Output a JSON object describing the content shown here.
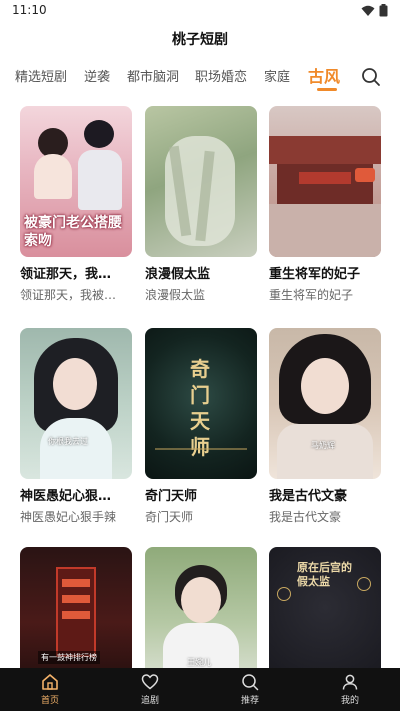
{
  "status": {
    "time": "11:10"
  },
  "app": {
    "title": "桃子短剧"
  },
  "tabs": [
    {
      "label": "精选短剧"
    },
    {
      "label": "逆袭"
    },
    {
      "label": "都市脑洞"
    },
    {
      "label": "职场婚恋"
    },
    {
      "label": "家庭"
    },
    {
      "label": "古风"
    }
  ],
  "active_tab": "古风",
  "cards": [
    {
      "title": "领证那天，我…",
      "subtitle": "领证那天，我被…",
      "poster_text": "被豪门老公搭腰索吻"
    },
    {
      "title": "浪漫假太监",
      "subtitle": "浪漫假太监"
    },
    {
      "title": "重生将军的妃子",
      "subtitle": "重生将军的妃子"
    },
    {
      "title": "神医愚妃心狠…",
      "subtitle": "神医愚妃心狠手辣",
      "poster_text": "你根我去过"
    },
    {
      "title": "奇门天师",
      "subtitle": "奇门天师",
      "poster_text": "奇门天师"
    },
    {
      "title": "我是古代文豪",
      "subtitle": "我是古代文豪",
      "poster_text": "马奶辉"
    },
    {
      "title": "",
      "subtitle": "",
      "poster_text": "有一鼓神排行榜"
    },
    {
      "title": "",
      "subtitle": "",
      "poster_text": "王婉儿"
    },
    {
      "title": "",
      "subtitle": "",
      "poster_text": "原在后宫的假太监"
    }
  ],
  "nav": [
    {
      "label": "首页"
    },
    {
      "label": "追剧"
    },
    {
      "label": "推荐"
    },
    {
      "label": "我的"
    }
  ],
  "colors": {
    "accent": "#f08a2a",
    "nav_bg": "#111111",
    "nav_active": "#f4b26a"
  }
}
